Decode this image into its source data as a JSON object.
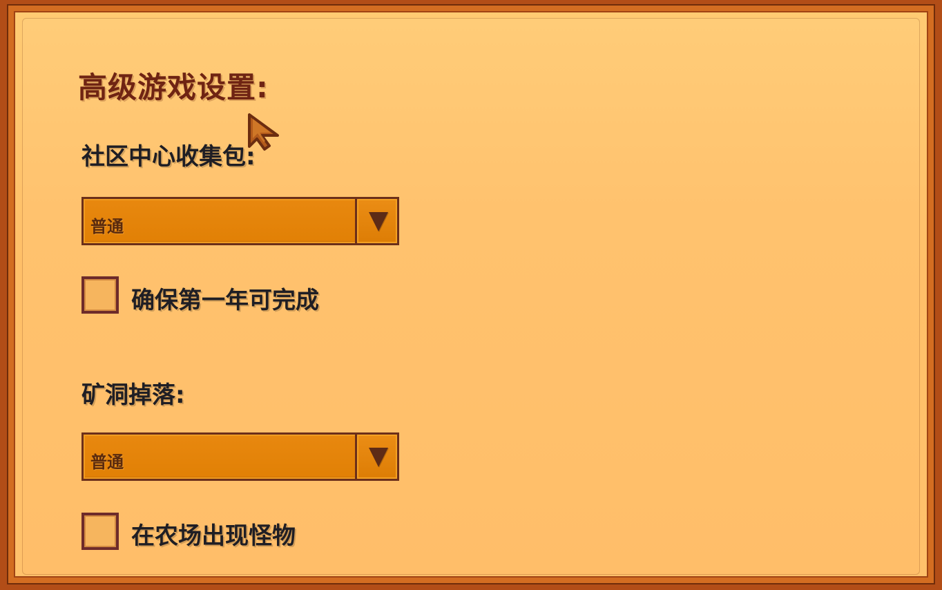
{
  "panel": {
    "title": "高级游戏设置:",
    "community_center_label": "社区中心收集包:",
    "community_center_dropdown": {
      "selected": "普通"
    },
    "checkbox_year_one": {
      "label": "确保第一年可完成",
      "checked": false
    },
    "mines_label": "矿洞掉落:",
    "mines_dropdown": {
      "selected": "普通"
    },
    "checkbox_monsters": {
      "label": "在农场出现怪物",
      "checked": false
    }
  },
  "colors": {
    "frame": "#b24d17",
    "panel": "#ffc26e",
    "dropdown": "#e18005",
    "title": "#6f2413",
    "text": "#1f1e24"
  },
  "icons": {
    "cursor": "pointer-cursor-icon",
    "dropdown": "dropdown-arrow-icon"
  }
}
